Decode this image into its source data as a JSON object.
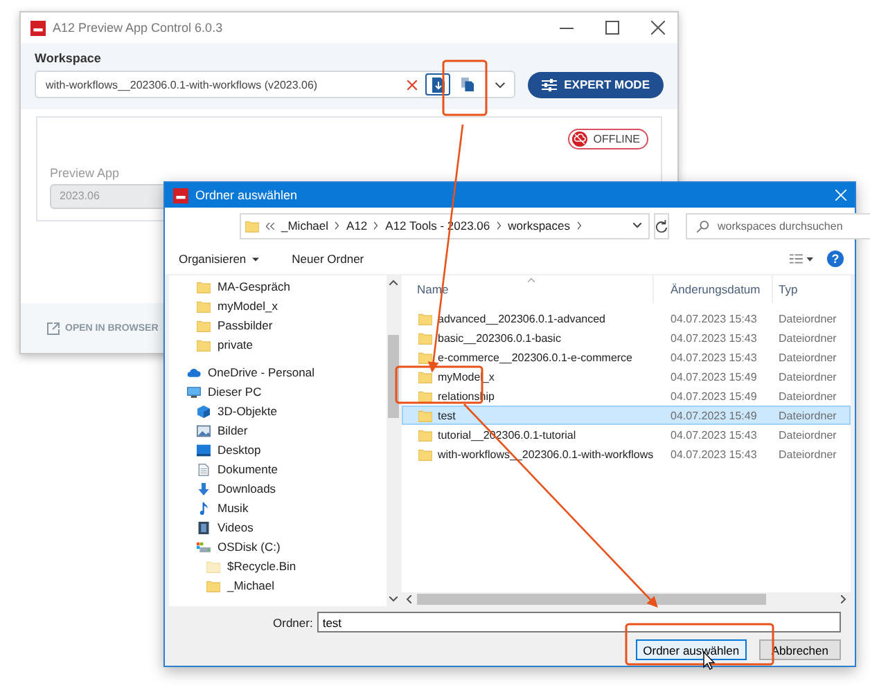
{
  "app_window": {
    "title": "A12 Preview App Control 6.0.3",
    "workspace_label": "Workspace",
    "workspace_value": "with-workflows__202306.0.1-with-workflows (v2023.06)",
    "expert_mode": "EXPERT MODE",
    "status_badge": "OFFLINE",
    "preview_app_label": "Preview App",
    "preview_app_value": "2023.06",
    "open_in_browser": "OPEN IN BROWSER"
  },
  "dialog": {
    "title": "Ordner auswählen",
    "path": [
      "_Michael",
      "A12",
      "A12 Tools - 2023.06",
      "workspaces"
    ],
    "search": {
      "placeholder": "workspaces durchsuchen"
    },
    "toolbar": {
      "organize": "Organisieren",
      "new_folder": "Neuer Ordner",
      "help": "?"
    },
    "tree_partial": [
      {
        "label": "MA-Gespräch",
        "kind": "folder"
      },
      {
        "label": "myModel_x",
        "kind": "folder"
      },
      {
        "label": "Passbilder",
        "kind": "folder"
      },
      {
        "label": "private",
        "kind": "folder"
      }
    ],
    "tree": [
      {
        "label": "OneDrive - Personal",
        "kind": "cloud"
      },
      {
        "label": "Dieser PC",
        "kind": "pc",
        "children": [
          {
            "label": "3D-Objekte",
            "kind": "cube"
          },
          {
            "label": "Bilder",
            "kind": "pictures"
          },
          {
            "label": "Desktop",
            "kind": "desktop"
          },
          {
            "label": "Dokumente",
            "kind": "document"
          },
          {
            "label": "Downloads",
            "kind": "download"
          },
          {
            "label": "Musik",
            "kind": "music"
          },
          {
            "label": "Videos",
            "kind": "video"
          },
          {
            "label": "OSDisk (C:)",
            "kind": "drive",
            "children": [
              {
                "label": "$Recycle.Bin",
                "kind": "hidden_folder"
              },
              {
                "label": "_Michael",
                "kind": "folder"
              }
            ]
          }
        ]
      }
    ],
    "columns": [
      "Name",
      "Änderungsdatum",
      "Typ"
    ],
    "rows": [
      {
        "name": "advanced__202306.0.1-advanced",
        "date": "04.07.2023 15:43",
        "type": "Dateiordner",
        "selected": false
      },
      {
        "name": "basic__202306.0.1-basic",
        "date": "04.07.2023 15:43",
        "type": "Dateiordner",
        "selected": false
      },
      {
        "name": "e-commerce__202306.0.1-e-commerce",
        "date": "04.07.2023 15:43",
        "type": "Dateiordner",
        "selected": false
      },
      {
        "name": "myModel_x",
        "date": "04.07.2023 15:49",
        "type": "Dateiordner",
        "selected": false
      },
      {
        "name": "relationship",
        "date": "04.07.2023 15:49",
        "type": "Dateiordner",
        "selected": false
      },
      {
        "name": "test",
        "date": "04.07.2023 15:49",
        "type": "Dateiordner",
        "selected": true
      },
      {
        "name": "tutorial__202306.0.1-tutorial",
        "date": "04.07.2023 15:43",
        "type": "Dateiordner",
        "selected": false
      },
      {
        "name": "with-workflows__202306.0.1-with-workflows",
        "date": "04.07.2023 15:43",
        "type": "Dateiordner",
        "selected": false
      }
    ],
    "folder_label": "Ordner:",
    "folder_value": "test",
    "buttons": [
      {
        "label": "Ordner auswählen",
        "kind": "primary"
      },
      {
        "label": "Abbrechen",
        "kind": "secondary"
      }
    ]
  }
}
